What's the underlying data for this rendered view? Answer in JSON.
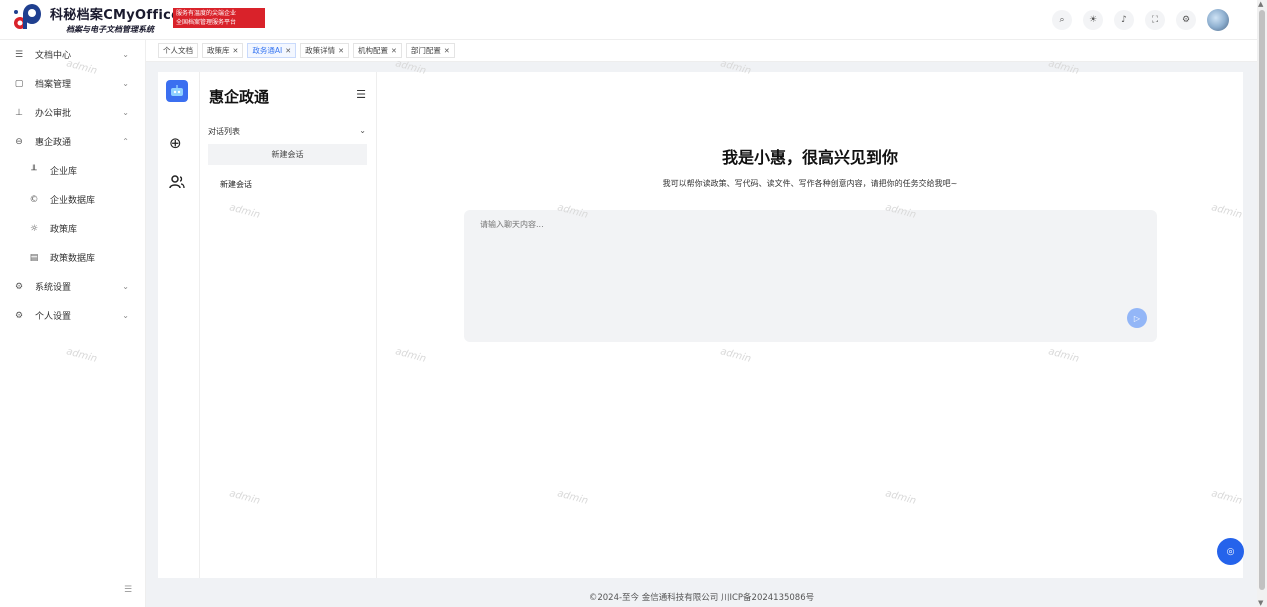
{
  "header": {
    "brand_title": "科秘档案CMyOffice",
    "brand_subtitle": "档案与电子文档管理系统",
    "slogan_line1": "服务有温度的尖端企业",
    "slogan_line2": "全国档案管理服务平台",
    "actions": [
      "search-icon",
      "theme-icon",
      "bell-icon",
      "fullscreen-icon",
      "settings-icon",
      "avatar"
    ]
  },
  "sidebar": {
    "items": [
      {
        "label": "文档中心",
        "icon": "menu-lines-icon",
        "arrow": "⌄"
      },
      {
        "label": "档案管理",
        "icon": "archive-icon",
        "arrow": "⌄"
      },
      {
        "label": "办公审批",
        "icon": "stamp-icon",
        "arrow": "⌄"
      },
      {
        "label": "惠企政通",
        "icon": "robot-icon",
        "arrow": "⌃"
      }
    ],
    "subitems": [
      {
        "label": "企业库",
        "icon": "bar-chart-icon"
      },
      {
        "label": "企业数据库",
        "icon": "copyright-icon"
      },
      {
        "label": "政策库",
        "icon": "sun-icon"
      },
      {
        "label": "政策数据库",
        "icon": "table-icon"
      }
    ],
    "bottom_items": [
      {
        "label": "系统设置",
        "icon": "gear-icon",
        "arrow": "⌄"
      },
      {
        "label": "个人设置",
        "icon": "gear-icon",
        "arrow": "⌄"
      }
    ]
  },
  "tabs": [
    {
      "label": "个人文档",
      "closable": false,
      "active": false
    },
    {
      "label": "政策库",
      "closable": true,
      "active": false
    },
    {
      "label": "政务通AI",
      "closable": true,
      "active": true
    },
    {
      "label": "政策详情",
      "closable": true,
      "active": false
    },
    {
      "label": "机构配置",
      "closable": true,
      "active": false
    },
    {
      "label": "部门配置",
      "closable": true,
      "active": false
    }
  ],
  "conversation": {
    "title": "惠企政通",
    "list_label": "对话列表",
    "new_chat_button": "新建会话",
    "items": [
      "新建会话"
    ]
  },
  "chat": {
    "greeting": "我是小惠，很高兴见到你",
    "intro": "我可以帮你读政策、写代码、读文件、写作各种创意内容，请把你的任务交给我吧~",
    "input_placeholder": "请输入聊天内容..."
  },
  "footer": {
    "text": "©2024-至今 金信通科技有限公司    川ICP备2024135086号"
  },
  "watermark": "admin",
  "colors": {
    "accent": "#3a78f2",
    "brand_red": "#d9222a",
    "float_button": "#2563eb"
  }
}
